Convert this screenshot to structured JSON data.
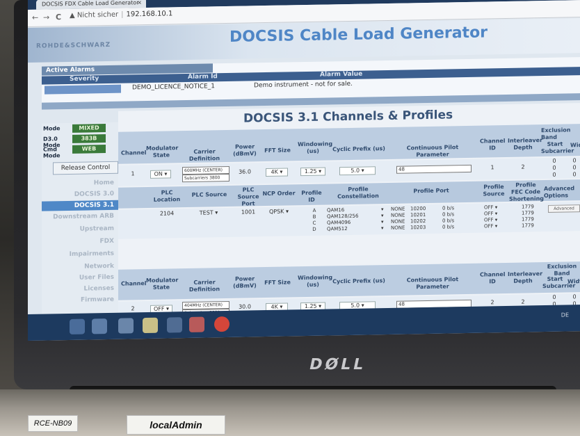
{
  "browser": {
    "tab_title": "DOCSIS FDX Cable Load Generator",
    "tab_close": "×",
    "nav_back": "←",
    "nav_forward": "→",
    "nav_reload": "C",
    "security_label": "▲ Nicht sicher",
    "url": "192.168.10.1"
  },
  "header": {
    "logo": "ROHDE&SCHWARZ",
    "title": "DOCSIS Cable Load Generator"
  },
  "alarms": {
    "section_title": "Active Alarms",
    "col_severity": "Severity",
    "col_alarm_id": "Alarm Id",
    "col_alarm_value": "Alarm Value",
    "rows": [
      {
        "alarm_id": "DEMO_LICENCE_NOTICE_1",
        "alarm_value": "Demo instrument - not for sale."
      }
    ]
  },
  "left_panel": {
    "mode_label": "Mode",
    "mode_value": "MIXED",
    "d30_label": "D3.0 Mode",
    "d30_value": "383B",
    "cmd_label": "Cmd Mode",
    "cmd_value": "WEB",
    "release_button": "Release Control",
    "menu": [
      "Home",
      "DOCSIS 3.0",
      "DOCSIS 3.1",
      "Downstream ARB",
      "Upstream",
      "FDX",
      "Impairments",
      "Network",
      "User Files",
      "Licenses",
      "Firmware"
    ]
  },
  "main": {
    "section_title": "DOCSIS 3.1 Channels & Profiles",
    "channel_headers": {
      "channel": "Channel",
      "modulator_state": "Modulator State",
      "carrier_definition": "Carrier Definition",
      "power": "Power (dBmV)",
      "fft_size": "FFT Size",
      "windowing": "Windowing (us)",
      "cyclic_prefix": "Cyclic Prefix (us)",
      "continuous_pilot": "Continuous Pilot Parameter",
      "channel_id": "Channel ID",
      "interleaver_depth": "Interleaver Depth",
      "exclusion_band": "Exclusion Band",
      "start_subcarrier": "Start Subcarrier",
      "width": "Width"
    },
    "profile_headers": {
      "plc_location": "PLC Location",
      "plc_source": "PLC Source",
      "plc_source_port": "PLC Source Port",
      "ncp_order": "NCP Order",
      "profile_id": "Profile ID",
      "profile_constellation": "Profile Constellation",
      "profile_port": "Profile Port",
      "profile_source": "Profile Source",
      "profile_fec": "Profile FEC Code Shortening",
      "advanced_options": "Advanced Options"
    },
    "channels": [
      {
        "channel": "1",
        "state": "ON",
        "carrier_line1": "600MHz (CENTER)",
        "carrier_line2": "Subcarriers 3800",
        "power": "36.0",
        "fft": "4K",
        "windowing": "1.25",
        "cyclic_prefix": "5.0",
        "pilot": "48",
        "channel_id": "1",
        "interleaver": "2",
        "excl_start": [
          "0",
          "0",
          "0"
        ],
        "excl_width": [
          "0",
          "0",
          "0"
        ],
        "plc_location": "2104",
        "plc_source": "TEST",
        "plc_source_port": "1001",
        "ncp_order": "QPSK",
        "profile_ids": [
          "A",
          "B",
          "C",
          "D"
        ],
        "constellations": [
          "QAM16",
          "QAM128/256",
          "QAM4096",
          "QAM512"
        ],
        "profile_ports": [
          {
            "src": "NONE",
            "port": "10200",
            "rate": "0 b/s"
          },
          {
            "src": "NONE",
            "port": "10201",
            "rate": "0 b/s"
          },
          {
            "src": "NONE",
            "port": "10202",
            "rate": "0 b/s"
          },
          {
            "src": "NONE",
            "port": "10203",
            "rate": "0 b/s"
          }
        ],
        "profile_sources": [
          "OFF",
          "OFF",
          "OFF",
          "OFF"
        ],
        "fec": [
          "1779",
          "1779",
          "1779",
          "1779"
        ],
        "advanced_button": "Advanced"
      },
      {
        "channel": "2",
        "state": "OFF",
        "carrier_line1": "404MHz (CENTER)",
        "carrier_line2": "Subcarriers 3800",
        "power": "30.0",
        "fft": "4K",
        "windowing": "1.25",
        "cyclic_prefix": "5.0",
        "pilot": "48",
        "channel_id": "2",
        "interleaver": "2",
        "excl_start": [
          "0",
          "0",
          "0"
        ],
        "excl_width": [
          "0",
          "0",
          "0"
        ]
      }
    ]
  },
  "laptop": {
    "brand": "DØLL",
    "sticker_left": "RCE-NB09",
    "sticker_right": "localAdmin",
    "tray_text": "DE"
  }
}
